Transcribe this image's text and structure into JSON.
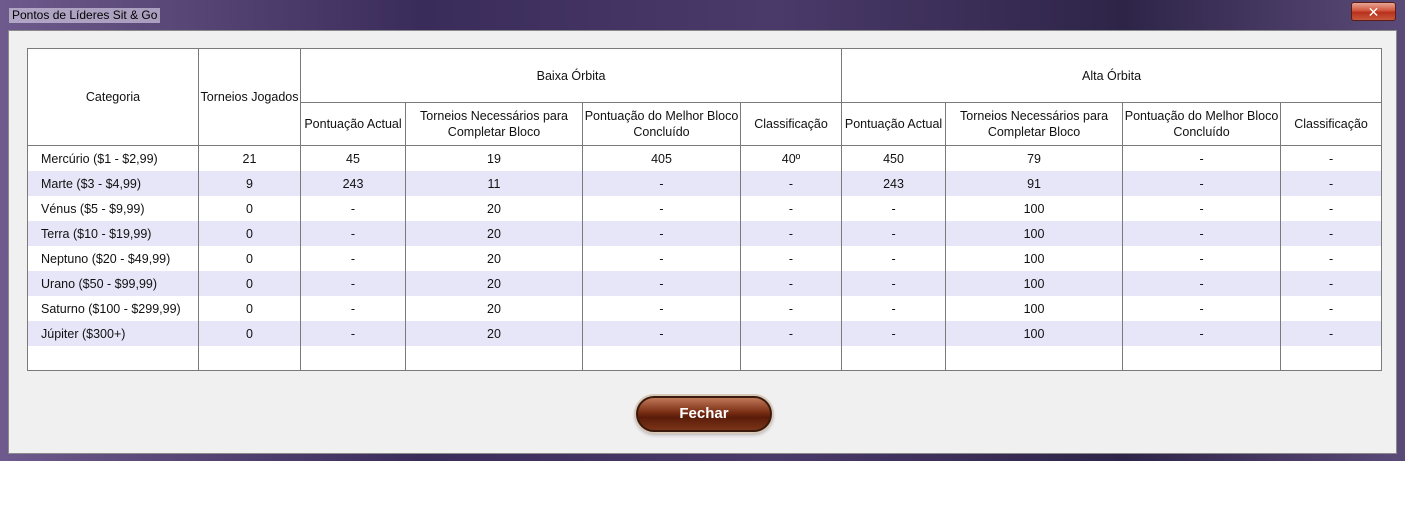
{
  "window": {
    "title": "Pontos de Líderes Sit & Go",
    "close_label": "✕"
  },
  "table": {
    "headers": {
      "category": "Categoria",
      "tournaments_played": "Torneios Jogados",
      "low_orbit": "Baixa Órbita",
      "high_orbit": "Alta Órbita",
      "sub": [
        "Pontuação Actual",
        "Torneios Necessários para Completar Bloco",
        "Pontuação do Melhor Bloco Concluído",
        "Classificação"
      ]
    },
    "rows": [
      [
        "Mercúrio ($1 - $2,99)",
        "21",
        "45",
        "19",
        "405",
        "40º",
        "450",
        "79",
        "-",
        "-"
      ],
      [
        "Marte ($3 - $4,99)",
        "9",
        "243",
        "11",
        "-",
        "-",
        "243",
        "91",
        "-",
        "-"
      ],
      [
        "Vénus ($5 - $9,99)",
        "0",
        "-",
        "20",
        "-",
        "-",
        "-",
        "100",
        "-",
        "-"
      ],
      [
        "Terra ($10 - $19,99)",
        "0",
        "-",
        "20",
        "-",
        "-",
        "-",
        "100",
        "-",
        "-"
      ],
      [
        "Neptuno ($20 - $49,99)",
        "0",
        "-",
        "20",
        "-",
        "-",
        "-",
        "100",
        "-",
        "-"
      ],
      [
        "Urano ($50 - $99,99)",
        "0",
        "-",
        "20",
        "-",
        "-",
        "-",
        "100",
        "-",
        "-"
      ],
      [
        "Saturno ($100 - $299,99)",
        "0",
        "-",
        "20",
        "-",
        "-",
        "-",
        "100",
        "-",
        "-"
      ],
      [
        "Júpiter ($300+)",
        "0",
        "-",
        "20",
        "-",
        "-",
        "-",
        "100",
        "-",
        "-"
      ]
    ]
  },
  "footer": {
    "close_button": "Fechar"
  },
  "colors": {
    "alt_row": "#e6e6f8",
    "button_brown": "#6b2a12"
  }
}
